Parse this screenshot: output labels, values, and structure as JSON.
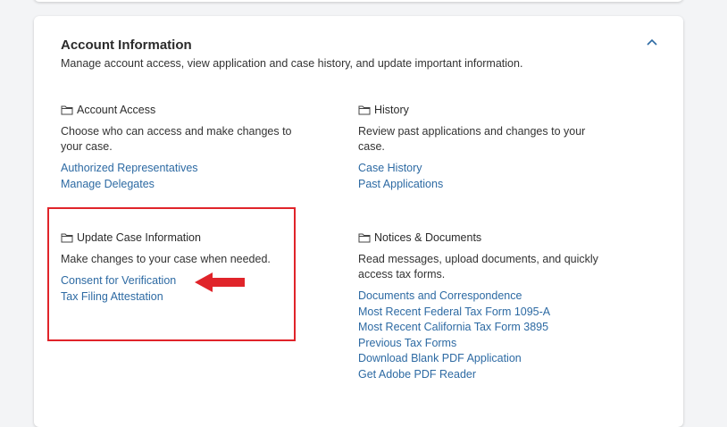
{
  "card": {
    "title": "Account Information",
    "subtitle": "Manage account access, view application and case history, and update important information."
  },
  "sections": {
    "account_access": {
      "title": "Account Access",
      "description": "Choose who can access and make changes to your case.",
      "links": [
        "Authorized Representatives",
        "Manage Delegates"
      ]
    },
    "history": {
      "title": "History",
      "description": "Review past applications and changes to your case.",
      "links": [
        "Case History",
        "Past Applications"
      ]
    },
    "update_case": {
      "title": "Update Case Information",
      "description": "Make changes to your case when needed.",
      "links": [
        "Consent for Verification",
        "Tax Filing Attestation"
      ]
    },
    "notices": {
      "title": "Notices & Documents",
      "description": "Read messages, upload documents, and quickly access tax forms.",
      "links": [
        "Documents and Correspondence",
        "Most Recent Federal Tax Form 1095-A",
        "Most Recent California Tax Form 3895",
        "Previous Tax Forms",
        "Download Blank PDF Application",
        "Get Adobe PDF Reader"
      ]
    }
  },
  "icons": {
    "section": "folder-icon",
    "collapse": "chevron-up-icon",
    "annotation": "arrow-left-icon"
  },
  "colors": {
    "link": "#2d6aa3",
    "highlight": "#e0242a",
    "text": "#333333"
  }
}
